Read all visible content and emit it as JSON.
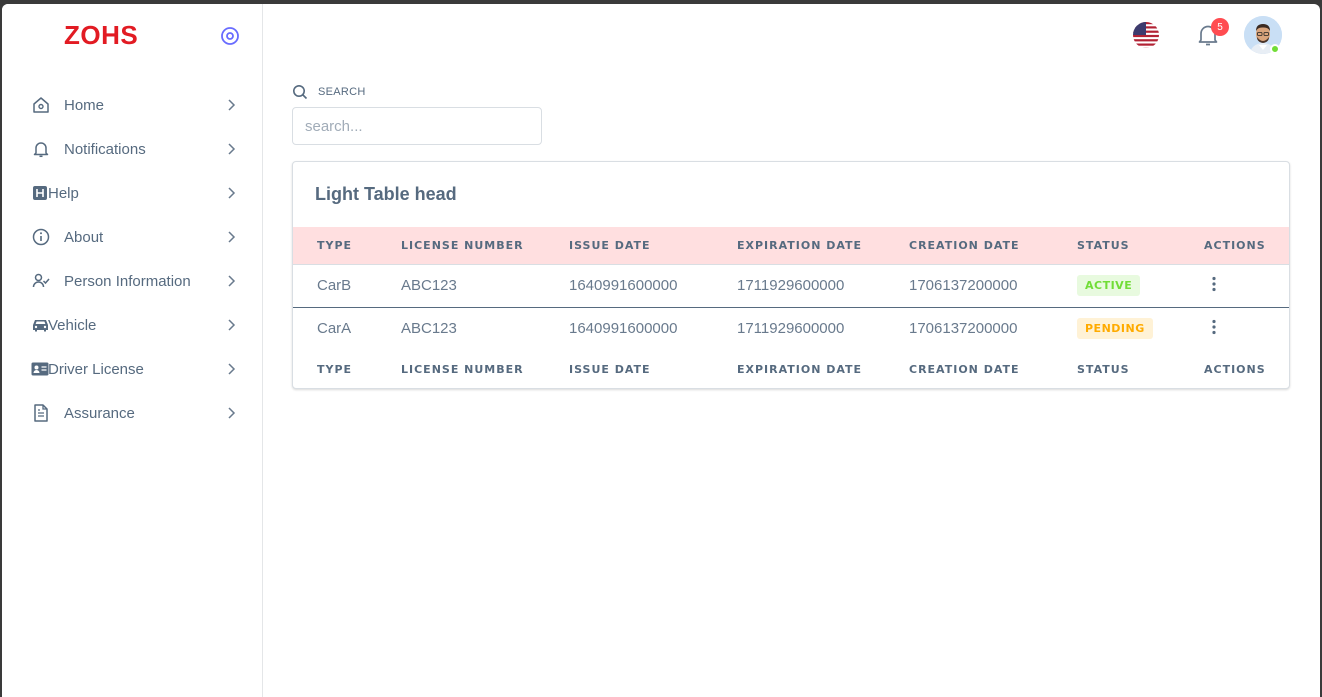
{
  "brand": {
    "name": "ZOHS",
    "color": "#e21b23"
  },
  "sidebar": {
    "toggle_icon": "target-circle-icon",
    "items": [
      {
        "label": "Home",
        "icon": "home-icon"
      },
      {
        "label": "Notifications",
        "icon": "bell-icon"
      },
      {
        "label": "Help",
        "icon": "help-box-icon"
      },
      {
        "label": "About",
        "icon": "info-circle-icon"
      },
      {
        "label": "Person Information",
        "icon": "user-check-icon"
      },
      {
        "label": "Vehicle",
        "icon": "car-icon"
      },
      {
        "label": "Driver License",
        "icon": "id-card-icon"
      },
      {
        "label": "Assurance",
        "icon": "document-icon"
      }
    ]
  },
  "topbar": {
    "language_icon": "us-flag-icon",
    "notifications_count": "5",
    "avatar_icon": "user-avatar-icon"
  },
  "search": {
    "label": "SEARCH",
    "placeholder": "search...",
    "value": ""
  },
  "table_card": {
    "title": "Light Table head",
    "columns": [
      "TYPE",
      "LICENSE NUMBER",
      "ISSUE DATE",
      "EXPIRATION DATE",
      "CREATION DATE",
      "STATUS",
      "ACTIONS"
    ],
    "rows": [
      {
        "type": "CarB",
        "license_number": "ABC123",
        "issue_date": "1640991600000",
        "expiration_date": "1711929600000",
        "creation_date": "1706137200000",
        "status": "ACTIVE"
      },
      {
        "type": "CarA",
        "license_number": "ABC123",
        "issue_date": "1640991600000",
        "expiration_date": "1711929600000",
        "creation_date": "1706137200000",
        "status": "PENDING"
      }
    ]
  },
  "colors": {
    "head_bg": "#ffdfe0",
    "active_badge": "#71dd37",
    "pending_badge": "#ffab00",
    "badge_red": "#ff4c51"
  }
}
